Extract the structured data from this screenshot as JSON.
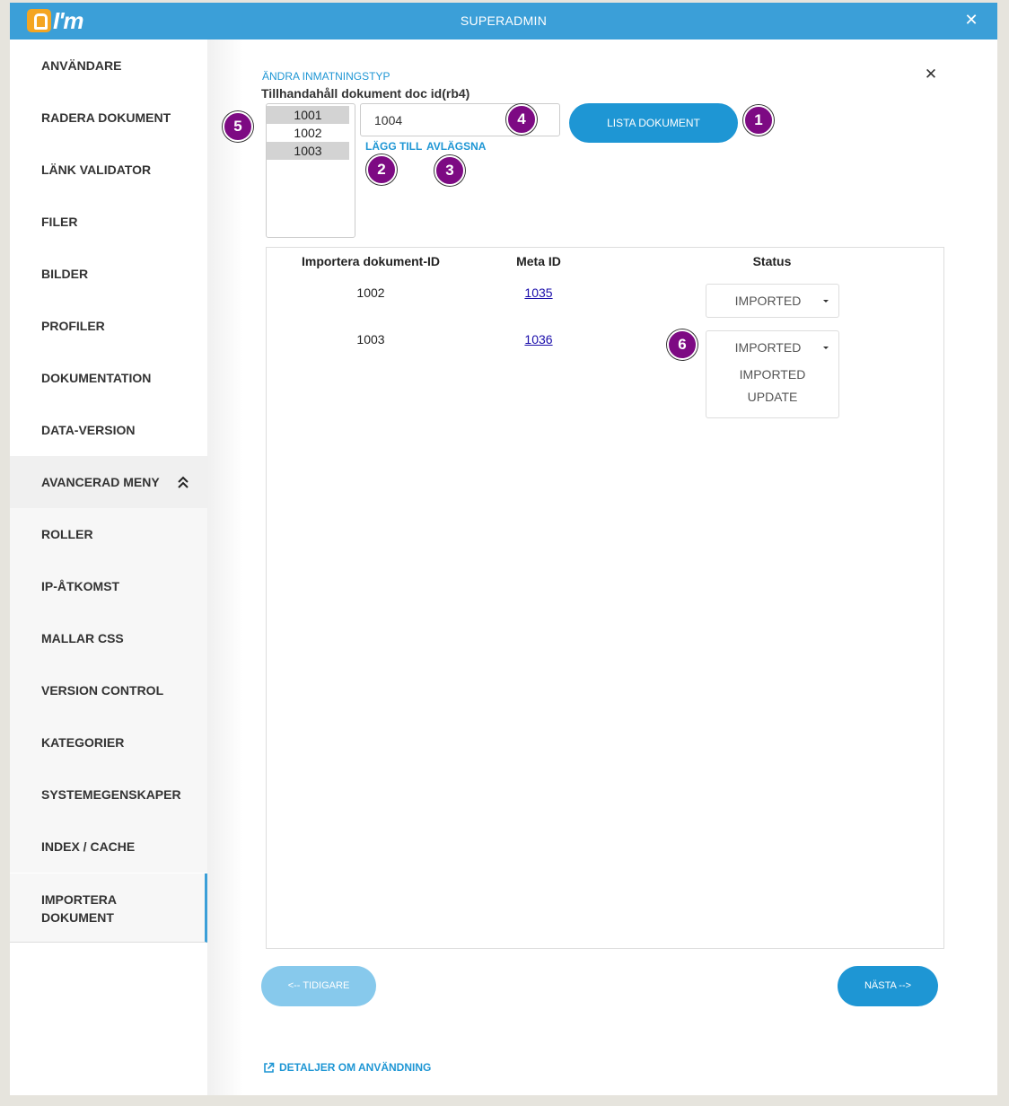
{
  "header": {
    "logo_text": "I'm",
    "title": "SUPERADMIN"
  },
  "sidebar": {
    "items": [
      {
        "label": "ANVÄNDARE"
      },
      {
        "label": "RADERA DOKUMENT"
      },
      {
        "label": "LÄNK VALIDATOR"
      },
      {
        "label": "FILER"
      },
      {
        "label": "BILDER"
      },
      {
        "label": "PROFILER"
      },
      {
        "label": "DOKUMENTATION"
      },
      {
        "label": "DATA-VERSION"
      },
      {
        "label": "AVANCERAD MENY"
      },
      {
        "label": "ROLLER"
      },
      {
        "label": "IP-ÅTKOMST"
      },
      {
        "label": "MALLAR CSS"
      },
      {
        "label": "VERSION CONTROL"
      },
      {
        "label": "KATEGORIER"
      },
      {
        "label": "SYSTEMEGENSKAPER"
      },
      {
        "label": "INDEX / CACHE"
      },
      {
        "label": "IMPORTERA DOKUMENT"
      }
    ]
  },
  "main": {
    "change_type_link": "ÄNDRA INMATNINGSTYP",
    "doc_label": "Tillhandahåll dokument doc id(rb4)",
    "id_list": [
      "1001",
      "1002",
      "1003"
    ],
    "id_input_value": "1004",
    "add_link": "LÄGG TILL",
    "remove_link": "AVLÄGSNA",
    "list_button": "LISTA DOKUMENT",
    "markers": [
      "1",
      "2",
      "3",
      "4",
      "5",
      "6"
    ],
    "table": {
      "headers": [
        "Importera dokument-ID",
        "Meta ID",
        "Status"
      ],
      "rows": [
        {
          "doc_id": "1002",
          "meta_id": "1035",
          "status": "IMPORTED"
        },
        {
          "doc_id": "1003",
          "meta_id": "1036",
          "status": "IMPORTED"
        }
      ],
      "status_options": [
        "IMPORTED",
        "UPDATE"
      ]
    },
    "prev_button": "<-- TIDIGARE",
    "next_button": "NÄSTA -->",
    "details_link": "DETALJER OM ANVÄNDNING"
  },
  "colors": {
    "header": "#3b9fd8",
    "accent": "#1e96d4",
    "marker": "#7d0a83",
    "logo": "#f4a522"
  }
}
